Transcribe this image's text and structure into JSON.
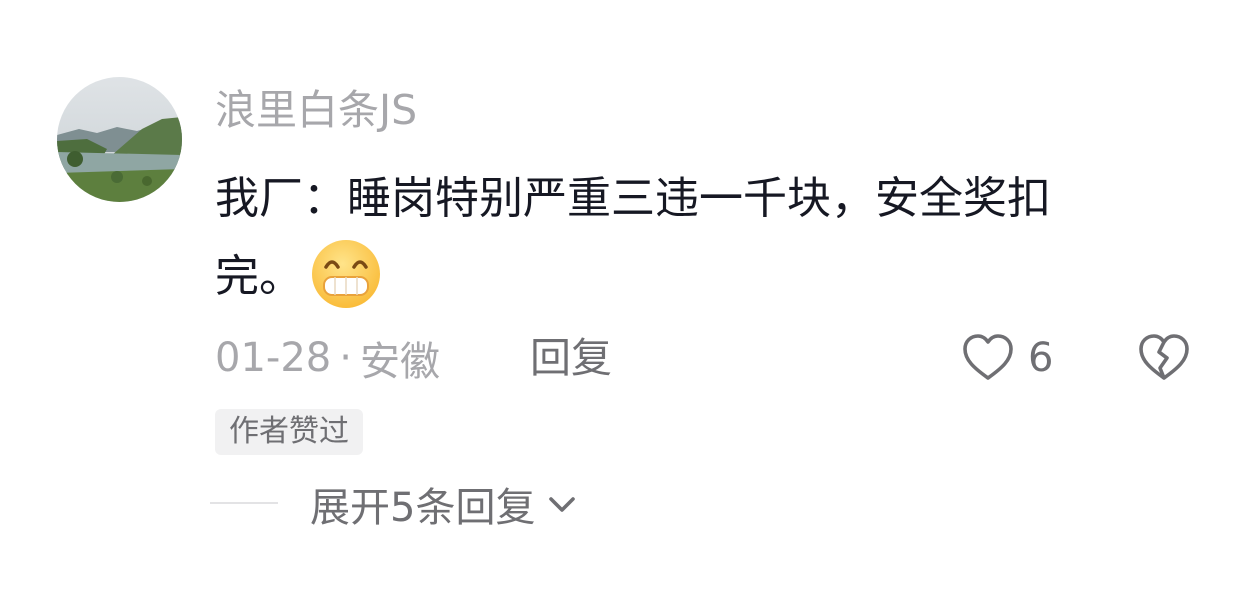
{
  "comment": {
    "username": "浪里白条JS",
    "text_line1": "我厂：睡岗特别严重三违一千块，安全奖扣",
    "text_line2": "完。",
    "emoji_icon": "grinning-face-icon",
    "date": "01-28",
    "separator": "·",
    "location": "安徽",
    "reply_label": "回复",
    "like_count": "6",
    "author_badge": "作者赞过",
    "expand_label": "展开5条回复"
  },
  "colors": {
    "text_primary": "#161823",
    "text_secondary": "#a7a7ab",
    "text_action": "#6f6f73",
    "badge_bg": "#f1f1f2"
  }
}
